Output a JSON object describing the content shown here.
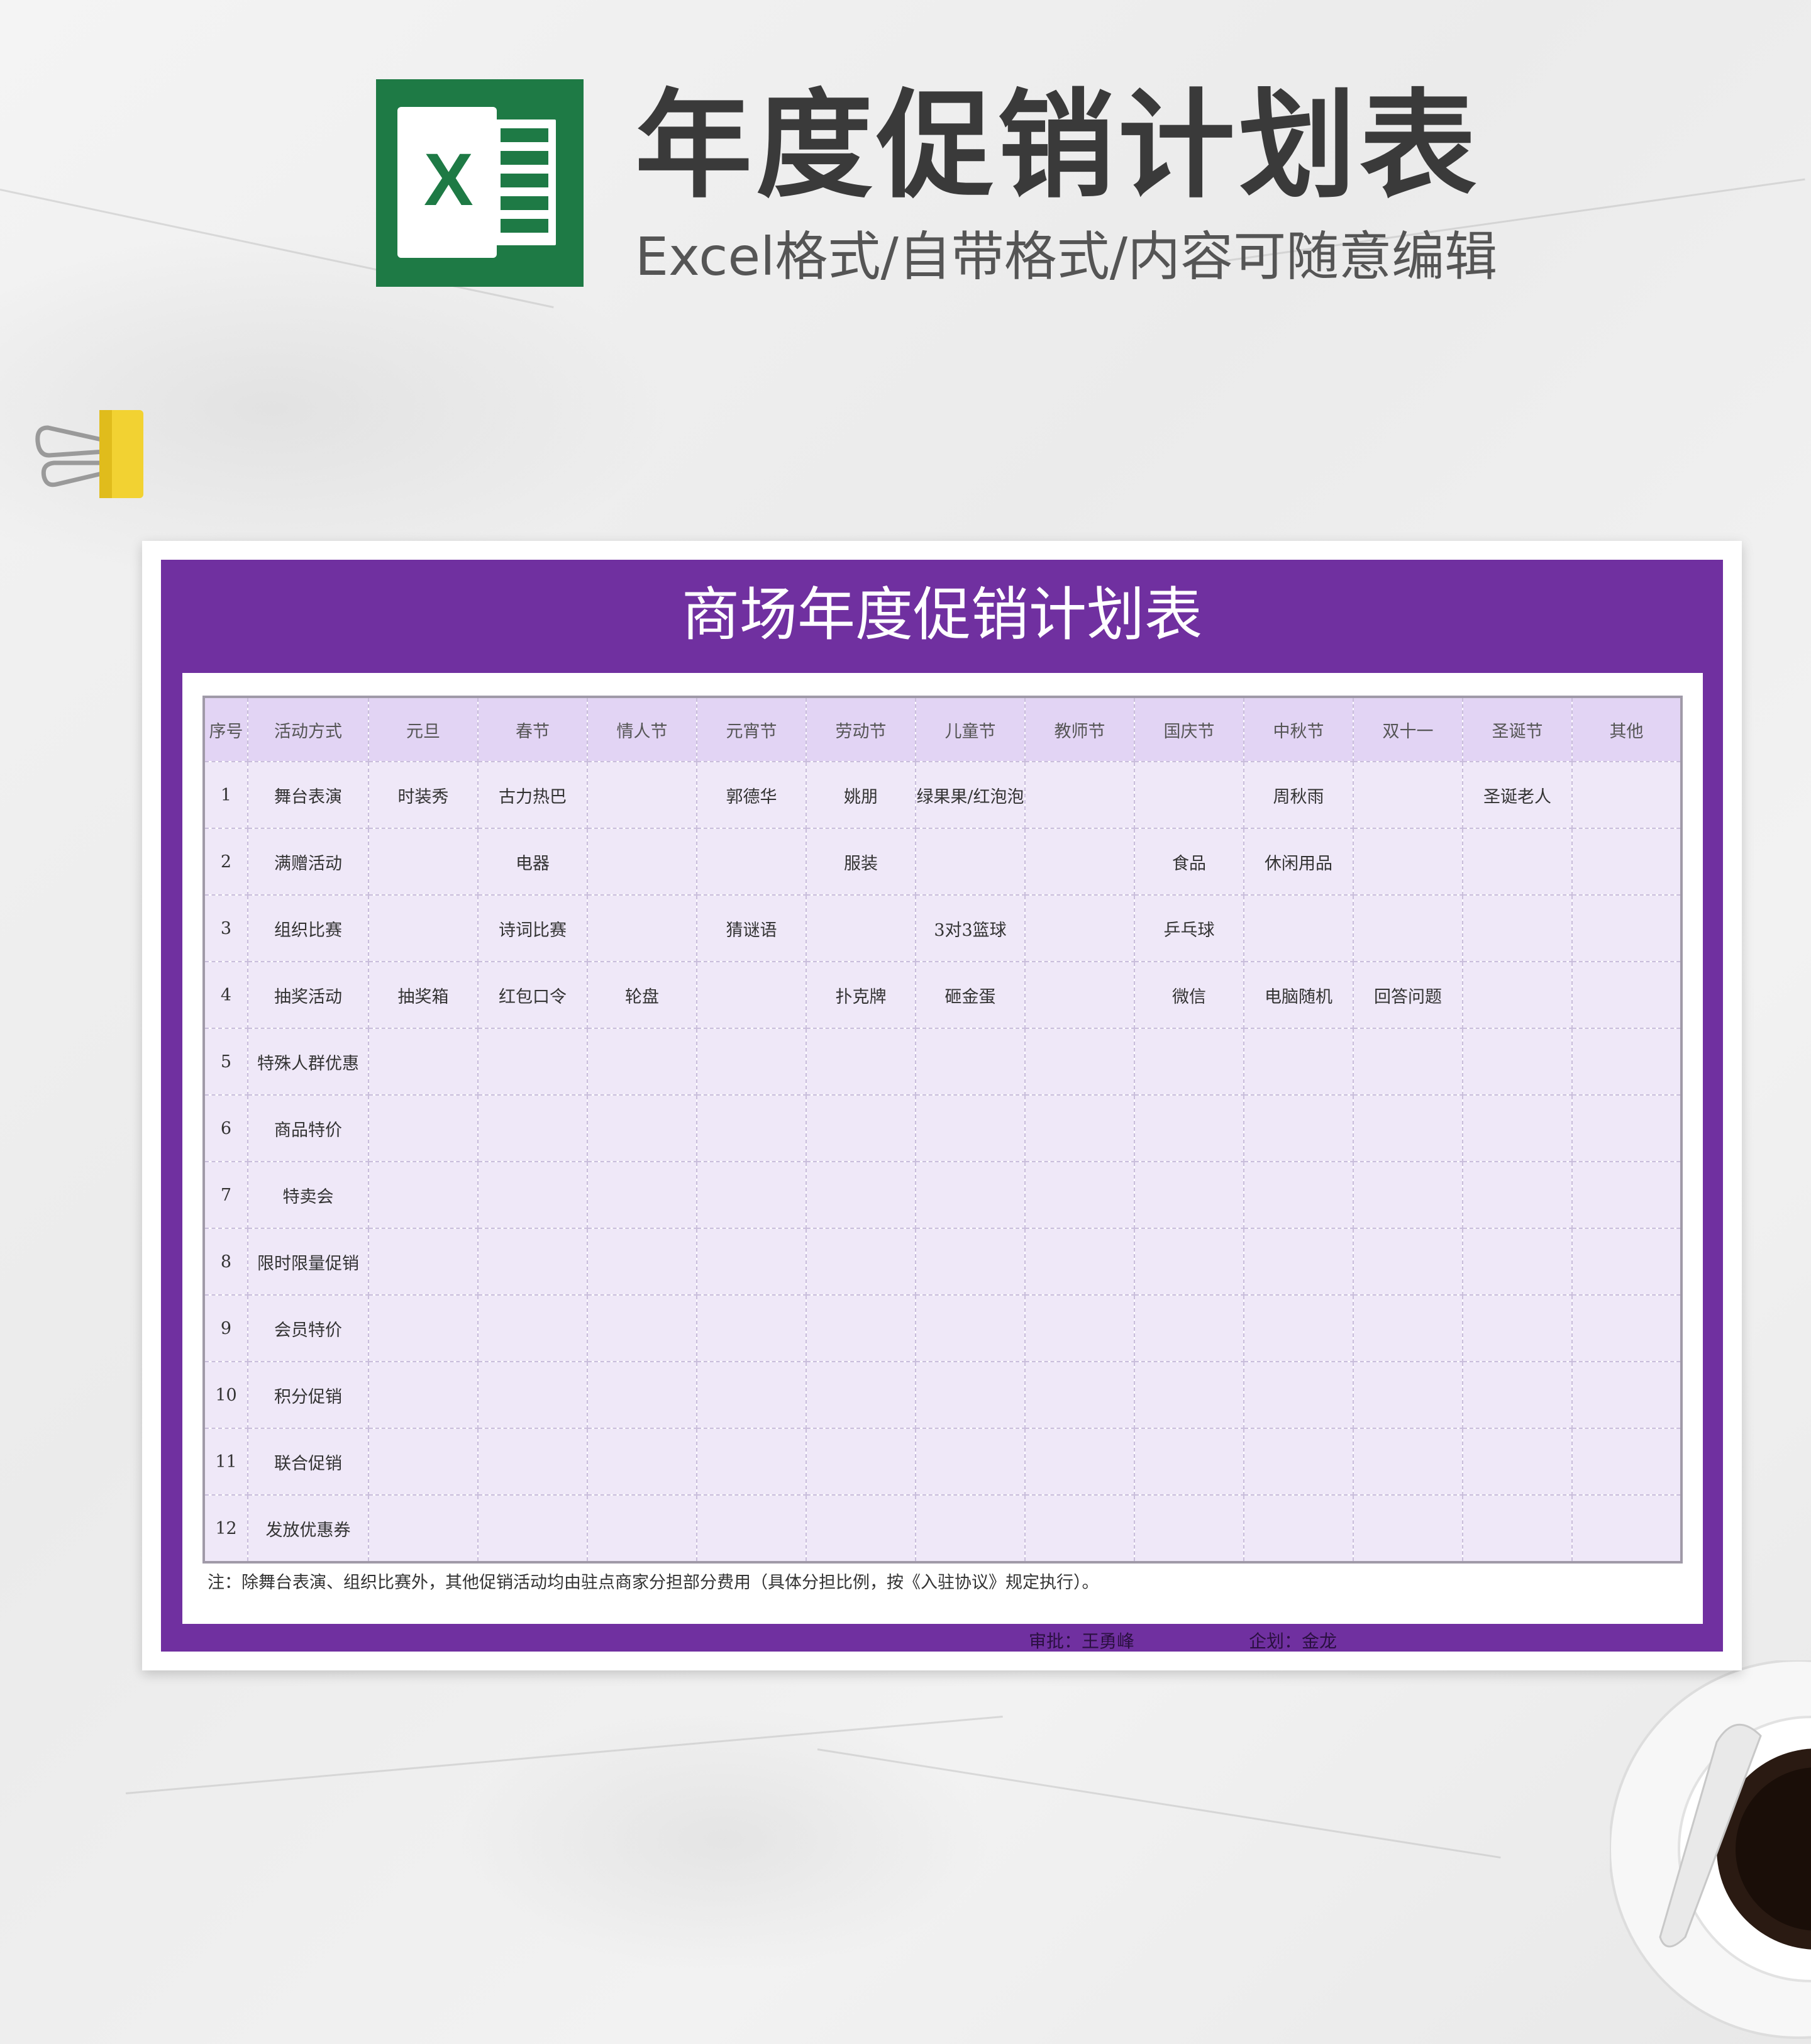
{
  "header": {
    "title": "年度促销计划表",
    "subtitle": "Excel格式/自带格式/内容可随意编辑",
    "logo_letter": "X"
  },
  "colors": {
    "sheet_purple": "#7030a0",
    "header_row": "#e2d4f4",
    "cell_bg": "#efe8f8",
    "excel_green": "#1e7a45"
  },
  "sheet": {
    "title": "商场年度促销计划表",
    "columns": [
      "序号",
      "活动方式",
      "元旦",
      "春节",
      "情人节",
      "元宵节",
      "劳动节",
      "儿童节",
      "教师节",
      "国庆节",
      "中秋节",
      "双十一",
      "圣诞节",
      "其他"
    ],
    "rows": [
      [
        "1",
        "舞台表演",
        "时装秀",
        "古力热巴",
        "",
        "郭德华",
        "姚朋",
        "绿果果/红泡泡",
        "",
        "",
        "周秋雨",
        "",
        "圣诞老人",
        ""
      ],
      [
        "2",
        "满赠活动",
        "",
        "电器",
        "",
        "",
        "服装",
        "",
        "",
        "食品",
        "休闲用品",
        "",
        "",
        ""
      ],
      [
        "3",
        "组织比赛",
        "",
        "诗词比赛",
        "",
        "猜谜语",
        "",
        "3对3篮球",
        "",
        "乒乓球",
        "",
        "",
        "",
        ""
      ],
      [
        "4",
        "抽奖活动",
        "抽奖箱",
        "红包口令",
        "轮盘",
        "",
        "扑克牌",
        "砸金蛋",
        "",
        "微信",
        "电脑随机",
        "回答问题",
        "",
        ""
      ],
      [
        "5",
        "特殊人群优惠",
        "",
        "",
        "",
        "",
        "",
        "",
        "",
        "",
        "",
        "",
        "",
        ""
      ],
      [
        "6",
        "商品特价",
        "",
        "",
        "",
        "",
        "",
        "",
        "",
        "",
        "",
        "",
        "",
        ""
      ],
      [
        "7",
        "特卖会",
        "",
        "",
        "",
        "",
        "",
        "",
        "",
        "",
        "",
        "",
        "",
        ""
      ],
      [
        "8",
        "限时限量促销",
        "",
        "",
        "",
        "",
        "",
        "",
        "",
        "",
        "",
        "",
        "",
        ""
      ],
      [
        "9",
        "会员特价",
        "",
        "",
        "",
        "",
        "",
        "",
        "",
        "",
        "",
        "",
        "",
        ""
      ],
      [
        "10",
        "积分促销",
        "",
        "",
        "",
        "",
        "",
        "",
        "",
        "",
        "",
        "",
        "",
        ""
      ],
      [
        "11",
        "联合促销",
        "",
        "",
        "",
        "",
        "",
        "",
        "",
        "",
        "",
        "",
        "",
        ""
      ],
      [
        "12",
        "发放优惠券",
        "",
        "",
        "",
        "",
        "",
        "",
        "",
        "",
        "",
        "",
        "",
        ""
      ]
    ],
    "note": "注：除舞台表演、组织比赛外，其他促销活动均由驻点商家分担部分费用（具体分担比例，按《入驻协议》规定执行）。",
    "approver": "审批：王勇峰",
    "planner": "企划：金龙"
  }
}
